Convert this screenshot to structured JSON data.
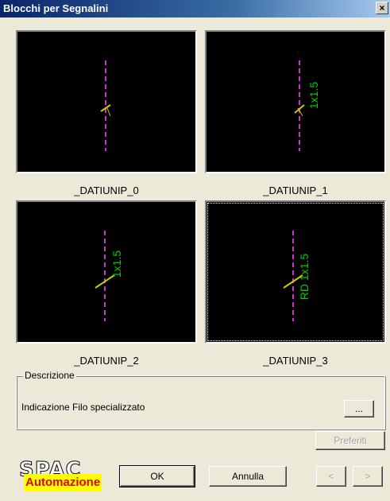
{
  "window": {
    "title": "Blocchi per Segnalini",
    "close_label": "×"
  },
  "tiles": [
    {
      "name": "_DATIUNIP_0",
      "text": ""
    },
    {
      "name": "_DATIUNIP_1",
      "text": "1x1.5"
    },
    {
      "name": "_DATIUNIP_2",
      "text": "1x1.5"
    },
    {
      "name": "_DATIUNIP_3",
      "text": "RD 1x1.5"
    }
  ],
  "colors": {
    "wire": "#cc33cc",
    "symbol": "#cccc00",
    "label": "#00cc00",
    "background": "#000000"
  },
  "description": {
    "legend": "Descrizione",
    "text": "Indicazione Filo specializzato",
    "browse_label": "..."
  },
  "buttons": {
    "preferiti": "Preferiti",
    "ok": "OK",
    "annulla": "Annulla",
    "prev": "<",
    "next": ">"
  },
  "logo": {
    "top": "SPAC",
    "band": "Automazione"
  }
}
